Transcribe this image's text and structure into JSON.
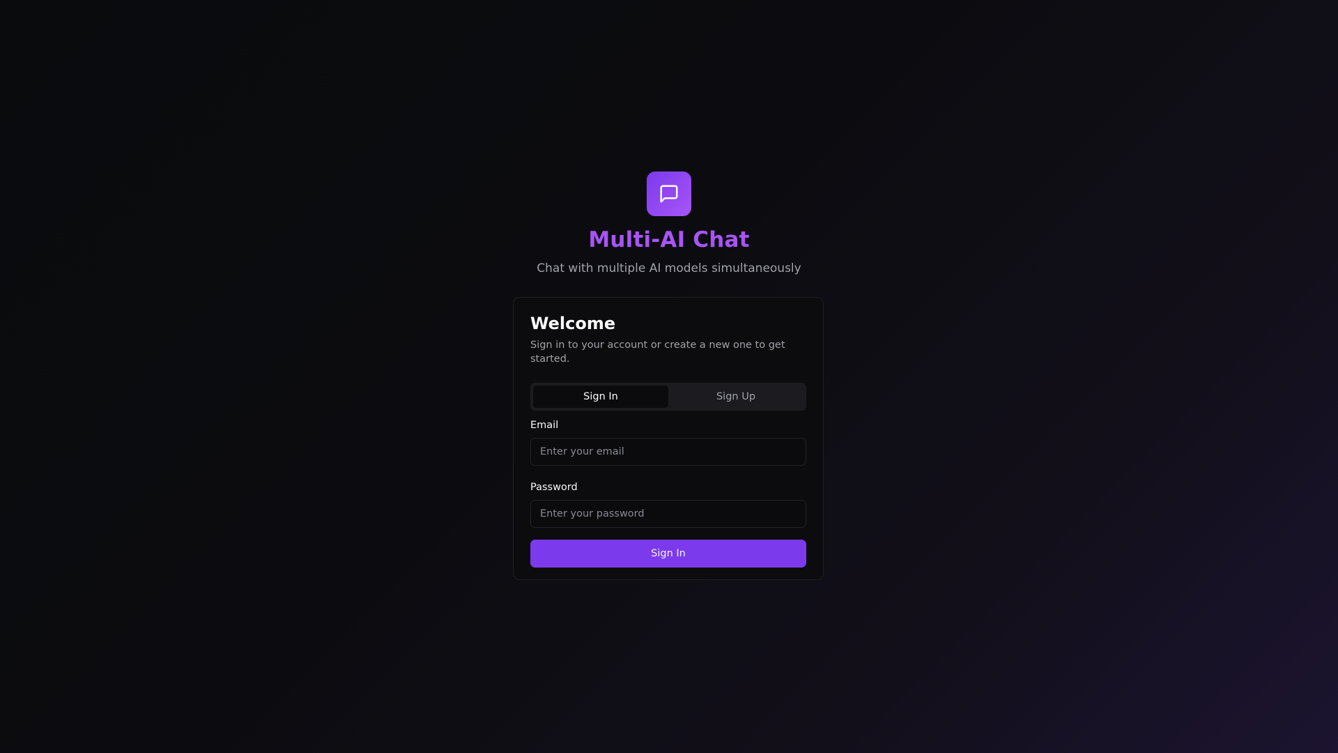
{
  "app": {
    "title": "Multi-AI Chat",
    "subtitle": "Chat with multiple AI models simultaneously",
    "logo_icon": "message-square-icon",
    "accent_color": "#7c3aed",
    "title_color": "#9d4edd"
  },
  "card": {
    "title": "Welcome",
    "description": "Sign in to your account or create a new one to get started."
  },
  "tabs": [
    {
      "label": "Sign In",
      "active": true
    },
    {
      "label": "Sign Up",
      "active": false
    }
  ],
  "form": {
    "email": {
      "label": "Email",
      "placeholder": "Enter your email",
      "value": ""
    },
    "password": {
      "label": "Password",
      "placeholder": "Enter your password",
      "value": ""
    },
    "submit_label": "Sign In"
  }
}
